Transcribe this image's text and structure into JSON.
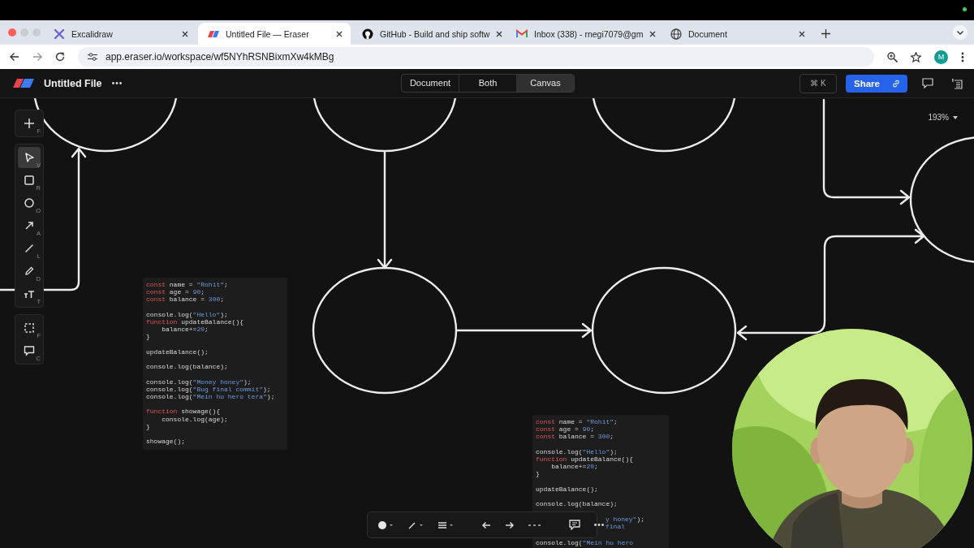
{
  "browser": {
    "tabs": [
      {
        "title": "Excalidraw",
        "kind": "excalidraw",
        "selected": false
      },
      {
        "title": "Untitled File — Eraser",
        "kind": "eraser",
        "selected": true
      },
      {
        "title": "GitHub - Build and ship softw",
        "kind": "github",
        "selected": false
      },
      {
        "title": "Inbox (338) - rnegi7079@gm",
        "kind": "gmail",
        "selected": false
      },
      {
        "title": "Document",
        "kind": "globe",
        "selected": false
      }
    ],
    "url": "app.eraser.io/workspace/wf5NYhRSNBixmXw4kMBg",
    "profile": "M"
  },
  "app": {
    "file_title": "Untitled File",
    "views": [
      {
        "label": "Document",
        "selected": false
      },
      {
        "label": "Both",
        "selected": false
      },
      {
        "label": "Canvas",
        "selected": true
      }
    ],
    "shortcut": "⌘ K",
    "share": "Share",
    "zoom": "193%"
  },
  "tool_groups": [
    [
      {
        "kind": "add",
        "shortcut": "F",
        "selected": false
      }
    ],
    [
      {
        "kind": "select",
        "shortcut": "V",
        "selected": true
      },
      {
        "kind": "rectangle",
        "shortcut": "R",
        "selected": false
      },
      {
        "kind": "ellipse",
        "shortcut": "O",
        "selected": false
      },
      {
        "kind": "arrow",
        "shortcut": "A",
        "selected": false
      },
      {
        "kind": "line",
        "shortcut": "L",
        "selected": false
      },
      {
        "kind": "pencil",
        "shortcut": "D",
        "selected": false
      },
      {
        "kind": "text",
        "shortcut": "T",
        "selected": false
      }
    ],
    [
      {
        "kind": "frame",
        "shortcut": "F",
        "selected": false
      },
      {
        "kind": "comment",
        "shortcut": "C",
        "selected": false
      }
    ]
  ],
  "code_blocks": [
    {
      "groups": [
        [
          [
            {
              "text": "const",
              "kind": "keyword"
            },
            {
              "text": " name = ",
              "kind": "plain"
            },
            {
              "text": "\"Rohit\"",
              "kind": "literal"
            },
            {
              "text": ";",
              "kind": "plain"
            }
          ],
          [
            {
              "text": "const",
              "kind": "keyword"
            },
            {
              "text": " age = ",
              "kind": "plain"
            },
            {
              "text": "90",
              "kind": "literal"
            },
            {
              "text": ";",
              "kind": "plain"
            }
          ],
          [
            {
              "text": "const",
              "kind": "keyword"
            },
            {
              "text": " balance = ",
              "kind": "plain"
            },
            {
              "text": "300",
              "kind": "literal"
            },
            {
              "text": ";",
              "kind": "plain"
            }
          ]
        ],
        [
          [
            {
              "text": "console.log(",
              "kind": "plain"
            },
            {
              "text": "\"Hello\"",
              "kind": "literal"
            },
            {
              "text": ");",
              "kind": "plain"
            }
          ],
          [
            {
              "text": "function",
              "kind": "keyword"
            },
            {
              "text": " updateBalance(){",
              "kind": "plain"
            }
          ],
          [
            {
              "text": "    balance+=",
              "kind": "plain"
            },
            {
              "text": "20",
              "kind": "literal"
            },
            {
              "text": ";",
              "kind": "plain"
            }
          ],
          [
            {
              "text": "}",
              "kind": "plain"
            }
          ]
        ],
        [
          [
            {
              "text": "updateBalance();",
              "kind": "plain"
            }
          ]
        ],
        [
          [
            {
              "text": "console.log(balance);",
              "kind": "plain"
            }
          ]
        ],
        [
          [
            {
              "text": "console.log(",
              "kind": "plain"
            },
            {
              "text": "\"Money honey\"",
              "kind": "literal"
            },
            {
              "text": ");",
              "kind": "plain"
            }
          ],
          [
            {
              "text": "console.log(",
              "kind": "plain"
            },
            {
              "text": "\"Bug final commit\"",
              "kind": "literal"
            },
            {
              "text": ");",
              "kind": "plain"
            }
          ],
          [
            {
              "text": "console.log(",
              "kind": "plain"
            },
            {
              "text": "\"Mein hu hero tera\"",
              "kind": "literal"
            },
            {
              "text": ");",
              "kind": "plain"
            }
          ]
        ],
        [
          [
            {
              "text": "function",
              "kind": "keyword"
            },
            {
              "text": " showage(){",
              "kind": "plain"
            }
          ],
          [
            {
              "text": "    console.log(age);",
              "kind": "plain"
            }
          ],
          [
            {
              "text": "}",
              "kind": "plain"
            }
          ]
        ],
        [
          [
            {
              "text": "showage();",
              "kind": "plain"
            }
          ]
        ]
      ]
    },
    {
      "groups": [
        [
          [
            {
              "text": "const",
              "kind": "keyword"
            },
            {
              "text": " name = ",
              "kind": "plain"
            },
            {
              "text": "\"Rohit\"",
              "kind": "literal"
            },
            {
              "text": ";",
              "kind": "plain"
            }
          ],
          [
            {
              "text": "const",
              "kind": "keyword"
            },
            {
              "text": " age = ",
              "kind": "plain"
            },
            {
              "text": "90",
              "kind": "literal"
            },
            {
              "text": ";",
              "kind": "plain"
            }
          ],
          [
            {
              "text": "const",
              "kind": "keyword"
            },
            {
              "text": " balance = ",
              "kind": "plain"
            },
            {
              "text": "300",
              "kind": "literal"
            },
            {
              "text": ";",
              "kind": "plain"
            }
          ]
        ],
        [
          [
            {
              "text": "console.log(",
              "kind": "plain"
            },
            {
              "text": "\"Hello\"",
              "kind": "literal"
            },
            {
              "text": ");",
              "kind": "plain"
            }
          ],
          [
            {
              "text": "function",
              "kind": "keyword"
            },
            {
              "text": " updateBalance(){",
              "kind": "plain"
            }
          ],
          [
            {
              "text": "    balance+=",
              "kind": "plain"
            },
            {
              "text": "20",
              "kind": "literal"
            },
            {
              "text": ";",
              "kind": "plain"
            }
          ],
          [
            {
              "text": "}",
              "kind": "plain"
            }
          ]
        ],
        [
          [
            {
              "text": "updateBalance();",
              "kind": "plain"
            }
          ]
        ],
        [
          [
            {
              "text": "console.log(balance);",
              "kind": "plain"
            }
          ]
        ],
        [
          [
            {
              "text": "y honey\"",
              "kind": "literal"
            },
            {
              "text": ");",
              "kind": "plain"
            }
          ],
          [
            {
              "text": "final",
              "kind": "literal"
            }
          ],
          [
            {
              "text": "console.log(",
              "kind": "plain"
            },
            {
              "text": "\"Mein hu hero",
              "kind": "literal"
            }
          ]
        ]
      ]
    }
  ],
  "webcam": {
    "kind": "picture"
  }
}
